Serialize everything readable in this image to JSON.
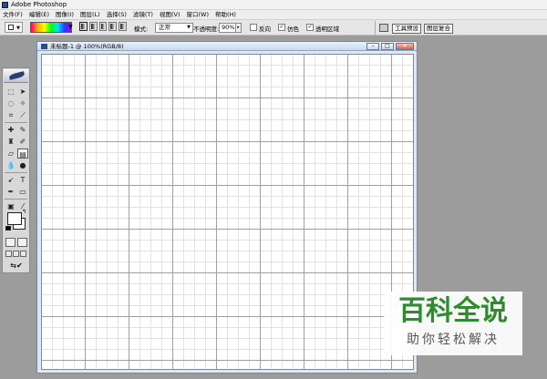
{
  "app": {
    "title": "Adobe Photoshop"
  },
  "menu": [
    "文件(F)",
    "编辑(E)",
    "图像(I)",
    "图层(L)",
    "选择(S)",
    "滤镜(T)",
    "视图(V)",
    "窗口(W)",
    "帮助(H)"
  ],
  "options_bar": {
    "mode_label": "模式:",
    "mode_value": "正常",
    "opacity_label": "不透明度:",
    "opacity_value": "90%",
    "reverse_label": "反向",
    "reverse_checked": false,
    "dither_label": "仿色",
    "dither_checked": true,
    "transparency_label": "透明区域",
    "transparency_checked": true
  },
  "palette_tabs": [
    "工具预设",
    "图层复合"
  ],
  "document": {
    "title": "未标题-1 @ 100%(RGB/8)"
  },
  "watermark": {
    "main": "百科全说",
    "sub": "助你轻松解决"
  },
  "colors": {
    "foreground": "#ffffff",
    "background": "#ffffff",
    "watermark_green": "#2e8b2e"
  },
  "tools": [
    "marquee-icon",
    "move-icon",
    "lasso-icon",
    "magic-wand-icon",
    "crop-icon",
    "slice-icon",
    "healing-brush-icon",
    "brush-icon",
    "clone-stamp-icon",
    "history-brush-icon",
    "eraser-icon",
    "gradient-icon",
    "blur-icon",
    "dodge-icon",
    "path-selection-icon",
    "type-icon",
    "pen-icon",
    "shape-icon",
    "notes-icon",
    "eyedropper-icon",
    "hand-icon",
    "zoom-icon"
  ]
}
